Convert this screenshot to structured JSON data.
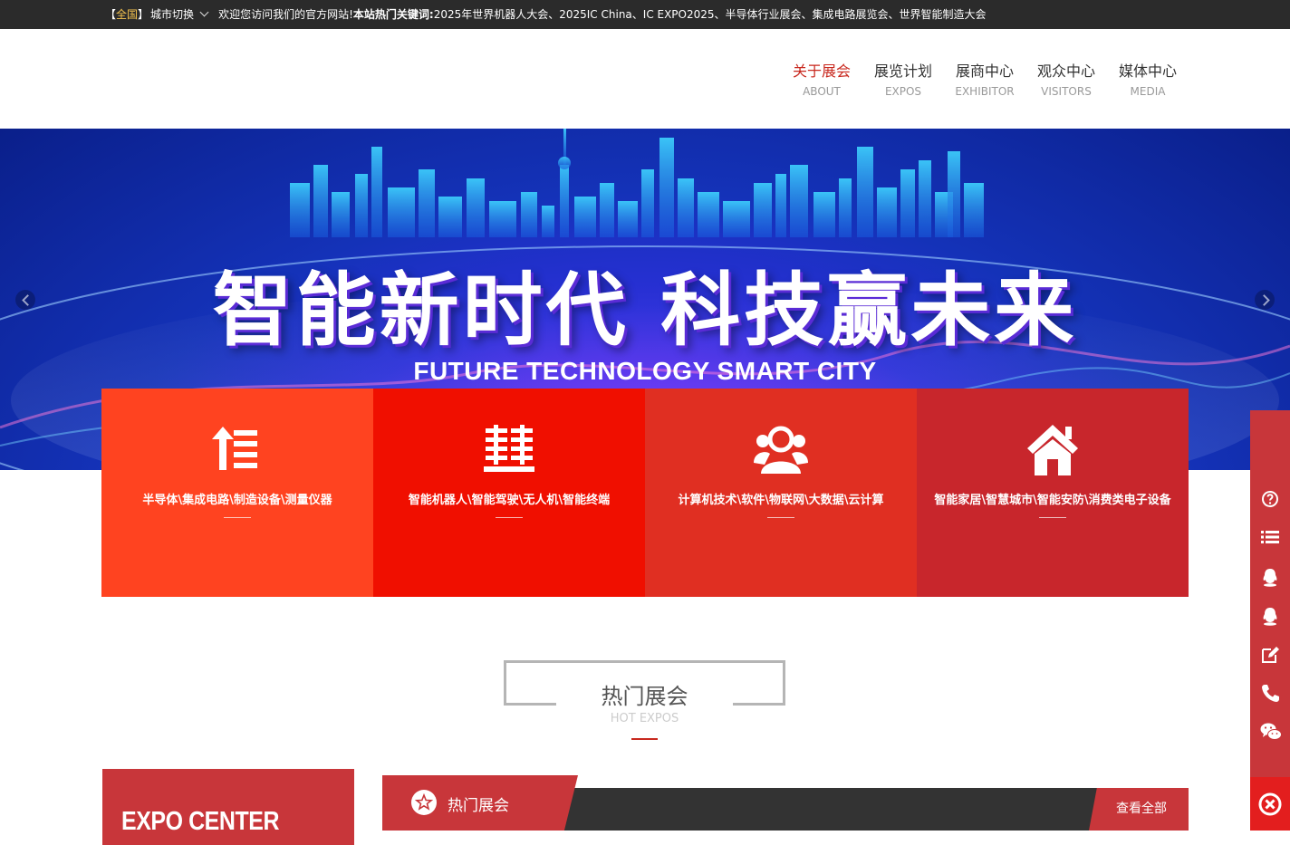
{
  "topbar": {
    "region_open": "【",
    "region": "全国",
    "region_close": "】",
    "city_switch": "城市切换",
    "welcome": "欢迎您访问我们的官方网站!",
    "hot_keywords_label": "本站热门关键词:",
    "hot_keywords": "2025年世界机器人大会、2025IC China、IC EXPO2025、半导体行业展会、集成电路展览会、世界智能制造大会"
  },
  "nav": {
    "items": [
      {
        "zh": "关于展会",
        "en": "ABOUT"
      },
      {
        "zh": "展览计划",
        "en": "EXPOS"
      },
      {
        "zh": "展商中心",
        "en": "EXHIBITOR"
      },
      {
        "zh": "观众中心",
        "en": "VISITORS"
      },
      {
        "zh": "媒体中心",
        "en": "MEDIA"
      }
    ],
    "active_index": 0
  },
  "banner": {
    "headline": "智能新时代  科技赢未来",
    "subline": "FUTURE TECHNOLOGY SMART CITY"
  },
  "categories": [
    {
      "label": "半导体\\集成电路\\制造设备\\测量仪器",
      "icon": "list-indent-icon",
      "color": "#ff4320"
    },
    {
      "label": "智能机器人\\智能驾驶\\无人机\\智能终端",
      "icon": "robot-chip-icon",
      "color": "#f00f00"
    },
    {
      "label": "计算机技术\\软件\\物联网\\大数据\\云计算",
      "icon": "users-group-icon",
      "color": "#e02f22"
    },
    {
      "label": "智能家居\\智慧城市\\智能安防\\消费类电子设备",
      "icon": "home-icon",
      "color": "#c8262c"
    }
  ],
  "section": {
    "title": "热门展会",
    "subtitle": "HOT EXPOS"
  },
  "expo_center": {
    "title": "EXPO CENTER"
  },
  "hot_expos_bar": {
    "tab_label": "热门展会",
    "more_label": "查看全部"
  },
  "sidebar": {
    "items": [
      "help-icon",
      "list-icon",
      "qq-icon",
      "qq-icon",
      "edit-icon",
      "phone-icon",
      "wechat-icon"
    ],
    "close": "close-icon"
  },
  "colors": {
    "accent": "#c8363a",
    "nav_active": "#c8281e",
    "topbar_bg": "#2b2b2b"
  }
}
